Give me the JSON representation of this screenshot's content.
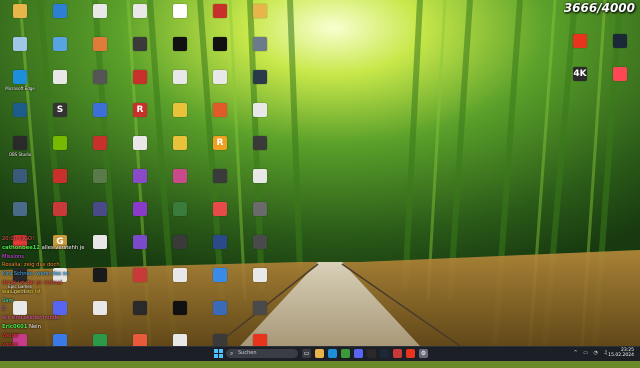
{
  "stream_overlay": {
    "counter": "3666/4000"
  },
  "desktop_icons": [
    {
      "name": "folder-icon",
      "label": "",
      "color": "#e8b54a",
      "glyph": ""
    },
    {
      "name": "app-icon",
      "label": "",
      "color": "#2d7fd4",
      "glyph": ""
    },
    {
      "name": "doc-icon",
      "label": "",
      "color": "#e8e8e8",
      "glyph": ""
    },
    {
      "name": "doc-icon",
      "label": "",
      "color": "#e8e8e8",
      "glyph": ""
    },
    {
      "name": "app-icon",
      "label": "",
      "color": "#ffffff",
      "glyph": ""
    },
    {
      "name": "app-icon",
      "label": "",
      "color": "#c8302c",
      "glyph": ""
    },
    {
      "name": "folder-icon",
      "label": "",
      "color": "#e8b54a",
      "glyph": ""
    },
    {
      "name": "recycle-bin-icon",
      "label": "",
      "color": "#9fc7e8",
      "glyph": ""
    },
    {
      "name": "app-icon",
      "label": "",
      "color": "#58a4e0",
      "glyph": ""
    },
    {
      "name": "app-icon",
      "label": "",
      "color": "#e07b3a",
      "glyph": ""
    },
    {
      "name": "app-icon",
      "label": "",
      "color": "#3a3a3a",
      "glyph": ""
    },
    {
      "name": "app-icon",
      "label": "",
      "color": "#111111",
      "glyph": ""
    },
    {
      "name": "app-icon",
      "label": "",
      "color": "#111111",
      "glyph": ""
    },
    {
      "name": "app-icon",
      "label": "",
      "color": "#6c7a8a",
      "glyph": ""
    },
    {
      "name": "edge-icon",
      "label": "Microsoft Edge",
      "color": "#1c8fd8",
      "glyph": ""
    },
    {
      "name": "doc-icon",
      "label": "",
      "color": "#e8e8e8",
      "glyph": ""
    },
    {
      "name": "app-icon",
      "label": "",
      "color": "#555555",
      "glyph": ""
    },
    {
      "name": "app-icon",
      "label": "",
      "color": "#c8302c",
      "glyph": ""
    },
    {
      "name": "doc-icon",
      "label": "",
      "color": "#e8e8e8",
      "glyph": ""
    },
    {
      "name": "doc-icon",
      "label": "",
      "color": "#e8e8e8",
      "glyph": ""
    },
    {
      "name": "app-icon",
      "label": "",
      "color": "#2a3a4a",
      "glyph": ""
    },
    {
      "name": "app-icon",
      "label": "",
      "color": "#1d5c8a",
      "glyph": ""
    },
    {
      "name": "app-icon",
      "label": "",
      "color": "#333333",
      "glyph": "S"
    },
    {
      "name": "app-icon",
      "label": "",
      "color": "#3d6fd8",
      "glyph": ""
    },
    {
      "name": "app-icon",
      "label": "",
      "color": "#c8302c",
      "glyph": "R"
    },
    {
      "name": "app-icon",
      "label": "",
      "color": "#e8c23a",
      "glyph": ""
    },
    {
      "name": "app-icon",
      "label": "",
      "color": "#e05a2a",
      "glyph": ""
    },
    {
      "name": "doc-icon",
      "label": "",
      "color": "#e8e8e8",
      "glyph": ""
    },
    {
      "name": "app-icon",
      "label": "OBS Studio",
      "color": "#2a2a2a",
      "glyph": ""
    },
    {
      "name": "app-icon",
      "label": "",
      "color": "#76b900",
      "glyph": ""
    },
    {
      "name": "app-icon",
      "label": "",
      "color": "#c8302c",
      "glyph": ""
    },
    {
      "name": "app-icon",
      "label": "",
      "color": "#e8e8e8",
      "glyph": ""
    },
    {
      "name": "app-icon",
      "label": "",
      "color": "#e8c23a",
      "glyph": ""
    },
    {
      "name": "app-icon",
      "label": "",
      "color": "#f0a020",
      "glyph": "R"
    },
    {
      "name": "app-icon",
      "label": "",
      "color": "#3a3a3a",
      "glyph": ""
    },
    {
      "name": "app-icon",
      "label": "",
      "color": "#3a5a7a",
      "glyph": ""
    },
    {
      "name": "app-icon",
      "label": "",
      "color": "#c8302c",
      "glyph": ""
    },
    {
      "name": "app-icon",
      "label": "",
      "color": "#5a7a4a",
      "glyph": ""
    },
    {
      "name": "app-icon",
      "label": "",
      "color": "#8a4ac8",
      "glyph": ""
    },
    {
      "name": "app-icon",
      "label": "",
      "color": "#c84a8a",
      "glyph": ""
    },
    {
      "name": "app-icon",
      "label": "",
      "color": "#3a3a3a",
      "glyph": ""
    },
    {
      "name": "app-icon",
      "label": "",
      "color": "#e8e8e8",
      "glyph": ""
    },
    {
      "name": "app-icon",
      "label": "",
      "color": "#4a6a8a",
      "glyph": ""
    },
    {
      "name": "app-icon",
      "label": "",
      "color": "#c83a3a",
      "glyph": ""
    },
    {
      "name": "app-icon",
      "label": "",
      "color": "#4a4a8a",
      "glyph": ""
    },
    {
      "name": "app-icon",
      "label": "",
      "color": "#8a3ac8",
      "glyph": ""
    },
    {
      "name": "app-icon",
      "label": "",
      "color": "#3a7a3a",
      "glyph": ""
    },
    {
      "name": "app-icon",
      "label": "",
      "color": "#e84a4a",
      "glyph": ""
    },
    {
      "name": "app-icon",
      "label": "",
      "color": "#6a6a6a",
      "glyph": ""
    },
    {
      "name": "app-icon",
      "label": "",
      "color": "#e83a3a",
      "glyph": ""
    },
    {
      "name": "app-icon",
      "label": "",
      "color": "#c89a3a",
      "glyph": "G"
    },
    {
      "name": "app-icon",
      "label": "",
      "color": "#e8e8e8",
      "glyph": ""
    },
    {
      "name": "app-icon",
      "label": "",
      "color": "#7a4ac8",
      "glyph": ""
    },
    {
      "name": "app-icon",
      "label": "",
      "color": "#3a3a3a",
      "glyph": ""
    },
    {
      "name": "app-icon",
      "label": "",
      "color": "#2a4a8a",
      "glyph": ""
    },
    {
      "name": "app-icon",
      "label": "",
      "color": "#4a4a4a",
      "glyph": ""
    },
    {
      "name": "app-icon",
      "label": "Epic Games Launcher",
      "color": "#2a2a2a",
      "glyph": ""
    },
    {
      "name": "doc-icon",
      "label": "",
      "color": "#e8e8e8",
      "glyph": ""
    },
    {
      "name": "app-icon",
      "label": "",
      "color": "#1a1a1a",
      "glyph": ""
    },
    {
      "name": "app-icon",
      "label": "",
      "color": "#c83a3a",
      "glyph": ""
    },
    {
      "name": "app-icon",
      "label": "",
      "color": "#e8e8e8",
      "glyph": ""
    },
    {
      "name": "app-icon",
      "label": "",
      "color": "#3a8ae8",
      "glyph": ""
    },
    {
      "name": "doc-icon",
      "label": "",
      "color": "#e8e8e8",
      "glyph": ""
    },
    {
      "name": "app-icon",
      "label": "",
      "color": "#e8e8e8",
      "glyph": ""
    },
    {
      "name": "app-icon",
      "label": "",
      "color": "#5865f2",
      "glyph": ""
    },
    {
      "name": "app-icon",
      "label": "",
      "color": "#e8e8e8",
      "glyph": ""
    },
    {
      "name": "app-icon",
      "label": "",
      "color": "#2a2a2a",
      "glyph": ""
    },
    {
      "name": "app-icon",
      "label": "",
      "color": "#111111",
      "glyph": ""
    },
    {
      "name": "app-icon",
      "label": "",
      "color": "#3a6ab8",
      "glyph": ""
    },
    {
      "name": "app-icon",
      "label": "",
      "color": "#4a4a4a",
      "glyph": ""
    },
    {
      "name": "app-icon",
      "label": "",
      "color": "#c83a8a",
      "glyph": ""
    },
    {
      "name": "app-icon",
      "label": "",
      "color": "#3a7ae8",
      "glyph": ""
    },
    {
      "name": "app-icon",
      "label": "",
      "color": "#2a9a4a",
      "glyph": ""
    },
    {
      "name": "app-icon",
      "label": "",
      "color": "#e85a3a",
      "glyph": ""
    },
    {
      "name": "app-icon",
      "label": "",
      "color": "#e8e8e8",
      "glyph": ""
    },
    {
      "name": "app-icon",
      "label": "",
      "color": "#3a3a3a",
      "glyph": ""
    },
    {
      "name": "app-icon",
      "label": "",
      "color": "#e8341c",
      "glyph": ""
    },
    {
      "name": "app-icon",
      "label": "",
      "color": "#e8341c",
      "glyph": ""
    },
    {
      "name": "app-icon",
      "label": "",
      "color": "#1b2838",
      "glyph": ""
    },
    {
      "name": "app-icon",
      "label": "",
      "color": "#2a2a2a",
      "glyph": "4K"
    },
    {
      "name": "app-icon",
      "label": "",
      "color": "#ff4655",
      "glyph": ""
    }
  ],
  "chat": [
    {
      "user": "",
      "text": "20:00 INGO!",
      "color": "#ff5a5a"
    },
    {
      "user": "cathonbee12",
      "text": "alles verstehh je",
      "color": "#4ae84a"
    },
    {
      "user": "",
      "text": "Missions",
      "color": "#e84aff"
    },
    {
      "user": "",
      "text": "Rosalia: zeig das doch",
      "color": "#ff8a3a"
    },
    {
      "user": "",
      "text": "Kira Schnee: wenn das so",
      "color": "#4ab8ff"
    },
    {
      "user": "",
      "text": "dreck ist der pc normal",
      "color": "#ff4a4a"
    },
    {
      "user": "",
      "text": "was geht so ist",
      "color": "#ffda3a"
    },
    {
      "user": "",
      "text": "Sam",
      "color": "#3ae8b8"
    },
    {
      "user": "",
      "text": "2",
      "color": "#b84aff"
    },
    {
      "user": "",
      "text": "wir sind wieder hunde",
      "color": "#ff5ab8"
    },
    {
      "user": "Eric0601",
      "text": "Nein",
      "color": "#4ae84a"
    },
    {
      "user": "",
      "text": "Weiter",
      "color": "#ff3a3a"
    },
    {
      "user": "",
      "text": "yoooo",
      "color": "#ff3a3a"
    }
  ],
  "taskbar": {
    "search_placeholder": "Suchen",
    "start_label": "Start",
    "time": "23:25",
    "date": "15.02.2024"
  }
}
